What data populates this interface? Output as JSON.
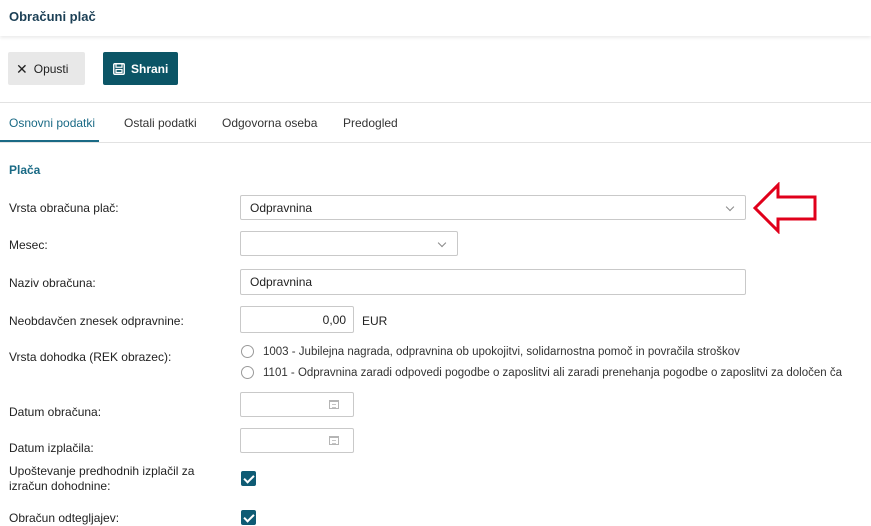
{
  "header": {
    "title": "Obračuni plač"
  },
  "toolbar": {
    "cancel_label": "Opusti",
    "save_label": "Shrani"
  },
  "tabs": [
    {
      "label": "Osnovni podatki",
      "active": true
    },
    {
      "label": "Ostali podatki",
      "active": false
    },
    {
      "label": "Odgovorna oseba",
      "active": false
    },
    {
      "label": "Predogled",
      "active": false
    }
  ],
  "section": {
    "title": "Plača"
  },
  "form": {
    "vrsta_obracuna": {
      "label": "Vrsta obračuna plač:",
      "value": "Odpravnina"
    },
    "mesec": {
      "label": "Mesec:",
      "value": ""
    },
    "naziv": {
      "label": "Naziv obračuna:",
      "value": "Odpravnina"
    },
    "znesek": {
      "label": "Neobdavčen znesek odpravnine:",
      "value": "0,00",
      "unit": "EUR"
    },
    "vrsta_dohodka": {
      "label": "Vrsta dohodka (REK obrazec):",
      "options": [
        "1003 - Jubilejna nagrada, odpravnina ob upokojitvi, solidarnostna pomoč in povračila stroškov",
        "1101 - Odpravnina zaradi odpovedi pogodbe o zaposlitvi ali zaradi prenehanja pogodbe o zaposlitvi za določen ča"
      ]
    },
    "datum_obracuna": {
      "label": "Datum obračuna:",
      "value": ""
    },
    "datum_izplacila": {
      "label": "Datum izplačila:",
      "value": ""
    },
    "upostevanje": {
      "label_line1": "Upoštevanje predhodnih izplačil za",
      "label_line2": "izračun dohodnine:",
      "checked": true
    },
    "odtegljaji": {
      "label": "Obračun odtegljajev:",
      "checked": true
    }
  },
  "colors": {
    "accent": "#1a6a85",
    "save_button": "#0b5566",
    "checkbox": "#0e5b74",
    "annotation_arrow": "#e0001b"
  }
}
